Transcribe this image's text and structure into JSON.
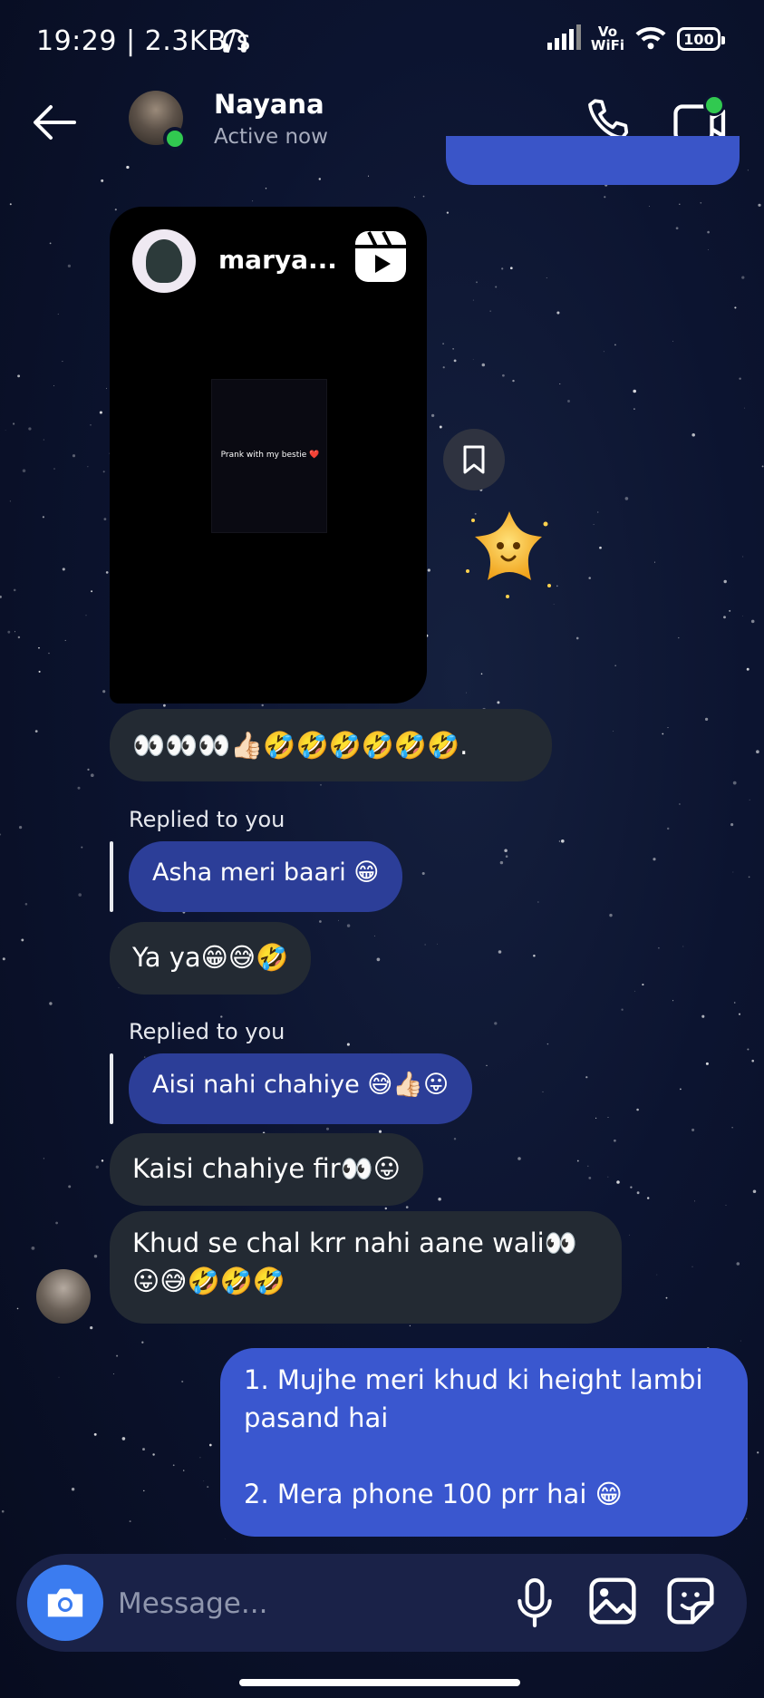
{
  "status_bar": {
    "time_speed": "19:29 | 2.3KB/s",
    "volte": "Vo\nWiFi",
    "battery": "100"
  },
  "header": {
    "contact_name": "Nayana",
    "contact_status": "Active now"
  },
  "reel": {
    "username": "marya...",
    "caption": "Prank with my bestie ❤️"
  },
  "messages": {
    "m1": "👀👀👀👍🏻🤣🤣🤣🤣🤣🤣.",
    "reply1_label": "Replied to you",
    "reply1_quote": "Asha meri baari 😁",
    "m2": "Ya ya😁😅🤣",
    "reply2_label": "Replied to you",
    "reply2_quote": "Aisi nahi chahiye 😅👍🏻😛",
    "m3": "Kaisi chahiye fir👀😛",
    "m4_line1": "Khud se chal krr nahi aane wali👀",
    "m4_line2": "😛😅🤣🤣🤣",
    "out_line1": "1. Mujhe meri khud ki height lambi",
    "out_line2": "pasand hai",
    "out_line3": "2. Mera phone 100 prr hai 😁"
  },
  "composer": {
    "placeholder": "Message..."
  },
  "colors": {
    "outgoing": "#3a57cf",
    "incoming": "#232a33",
    "quoted": "#2c3e98",
    "online": "#31c950",
    "camera": "#3b7cf0"
  }
}
